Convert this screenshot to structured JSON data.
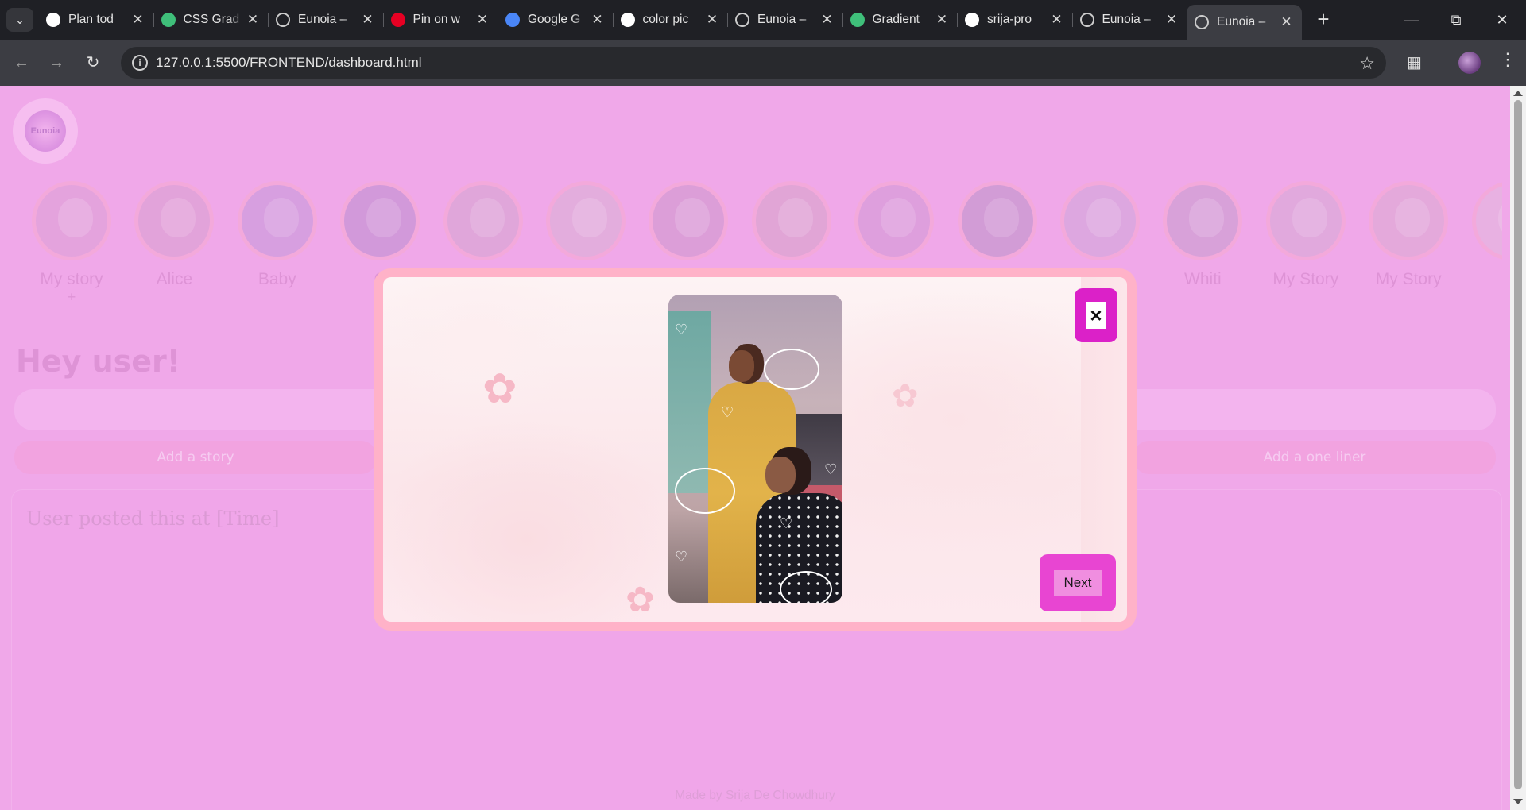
{
  "browser": {
    "tabs": [
      {
        "title": "Plan tod",
        "icon": "chatgpt-icon",
        "color": "#ffffff"
      },
      {
        "title": "CSS Grad",
        "icon": "css-gradient-icon",
        "color": "#3fbf7a"
      },
      {
        "title": "Eunoia –",
        "icon": "globe-icon",
        "color": "#cccccc"
      },
      {
        "title": "Pin on w",
        "icon": "pinterest-icon",
        "color": "#e60023"
      },
      {
        "title": "Google G",
        "icon": "gemini-icon",
        "color": "#4a86f7"
      },
      {
        "title": "color pic",
        "icon": "google-icon",
        "color": "#ffffff"
      },
      {
        "title": "Eunoia –",
        "icon": "globe-icon",
        "color": "#cccccc"
      },
      {
        "title": "Gradient",
        "icon": "gradient-icon",
        "color": "#3fbf7a"
      },
      {
        "title": "srija-pro",
        "icon": "github-icon",
        "color": "#ffffff"
      },
      {
        "title": "Eunoia –",
        "icon": "globe-icon",
        "color": "#cccccc"
      },
      {
        "title": "Eunoia –",
        "icon": "globe-icon",
        "color": "#cccccc",
        "active": true
      }
    ],
    "url": "127.0.0.1:5500/FRONTEND/dashboard.html"
  },
  "page": {
    "logo_text": "Eunoia",
    "stories": [
      {
        "name": "My story",
        "sub": "+"
      },
      {
        "name": "Alice",
        "sub": ""
      },
      {
        "name": "Baby",
        "sub": ""
      },
      {
        "name": "C",
        "sub": ""
      },
      {
        "name": "",
        "sub": ""
      },
      {
        "name": "",
        "sub": ""
      },
      {
        "name": "",
        "sub": ""
      },
      {
        "name": "",
        "sub": ""
      },
      {
        "name": "",
        "sub": ""
      },
      {
        "name": "",
        "sub": ""
      },
      {
        "name": "",
        "sub": ""
      },
      {
        "name": "Whiti",
        "sub": ""
      },
      {
        "name": "My Story",
        "sub": ""
      },
      {
        "name": "My Story",
        "sub": ""
      },
      {
        "name": "M",
        "sub": ""
      }
    ],
    "greeting": "Hey user!",
    "add_story_label": "Add a story",
    "add_one_liner_label": "Add a one liner",
    "feed_caption": "User posted this at [Time]",
    "footer": "Made by Srija De Chowdhury"
  },
  "modal": {
    "close_label": "×",
    "next_label": "Next"
  },
  "colors": {
    "page_bg": "#f0a7e9",
    "modal_frame": "#ffb2c8",
    "close_button": "#db21c8",
    "next_button": "#e845d2"
  }
}
